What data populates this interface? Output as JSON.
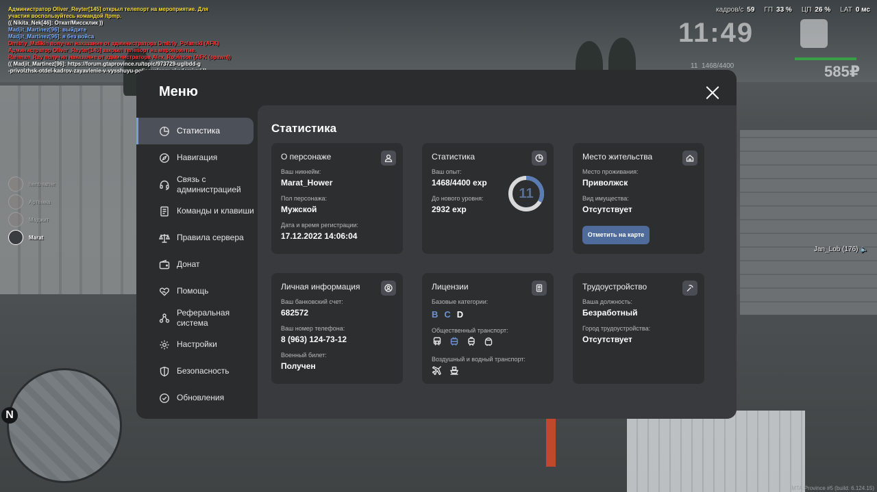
{
  "hud": {
    "fps_label": "кадров/с",
    "fps_value": "59",
    "gpu_label": "ГП",
    "gpu_value": "33 %",
    "cpu_label": "ЦП",
    "cpu_value": "26 %",
    "lat_label": "LAT",
    "lat_value": "0 мс",
    "time": "11:49",
    "xp": "1468/4400",
    "level_small": "11",
    "money": "585₽",
    "speaker": "Jan_Lob (176)",
    "build": "MTA:Province #5 (build: 6.124.15)"
  },
  "chat": [
    {
      "color": "c-admin",
      "text": "Администратор Oliver_Reyter[145] открыл телепорт на мероприятие. Для"
    },
    {
      "color": "c-admin",
      "text": " участия воспользуйтесь командой /tpmp."
    },
    {
      "color": "c-white",
      "text": "(( Nikita_Nek[46]: Откат/Миссклик ))"
    },
    {
      "color": "c-blue",
      "text": "Madjit_Martinez[96]: выйдите"
    },
    {
      "color": "c-blue",
      "text": "Madjit_Martinez[96]: я без войса"
    },
    {
      "color": "c-red",
      "text": "Dmitriy_Malikin получил наказание от администратора Dmitriy_Polanski (AFK)"
    },
    {
      "color": "c-red",
      "text": "Администратор Oliver_Reyter[145] закрыл телепорт на мероприятие."
    },
    {
      "color": "c-red",
      "text": "Rahman_Ray получил наказание от администратора Alex_Robinson (AFK (spawn))"
    },
    {
      "color": "c-white",
      "text": "(( Madjit_Martinez[96]: https://forum.gtaprovince.ru/topic/973729-ugibdd-g"
    },
    {
      "color": "c-white",
      "text": "-privolzhsk-otdel-kadrov-zayavlenie-v-vysshuyu-policeyskuyu-akademiyu/ ))"
    }
  ],
  "voice": [
    {
      "name": "hentreaher"
    },
    {
      "name": "Артёмка"
    },
    {
      "name": "Маджит"
    },
    {
      "name": "Marat"
    }
  ],
  "minimap": {
    "north": "N"
  },
  "menu": {
    "title": "Меню",
    "nav": [
      {
        "label": "Статистика",
        "icon": "pie-chart-icon",
        "active": true
      },
      {
        "label": "Навигация",
        "icon": "compass-icon"
      },
      {
        "label": "Связь с администрацией",
        "icon": "headset-icon"
      },
      {
        "label": "Команды и клавиши",
        "icon": "document-icon"
      },
      {
        "label": "Правила сервера",
        "icon": "scales-icon"
      },
      {
        "label": "Донат",
        "icon": "wallet-icon"
      },
      {
        "label": "Помощь",
        "icon": "heart-hands-icon"
      },
      {
        "label": "Реферальная система",
        "icon": "referral-icon"
      },
      {
        "label": "Настройки",
        "icon": "gear-icon"
      },
      {
        "label": "Безопасность",
        "icon": "shield-icon"
      },
      {
        "label": "Обновления",
        "icon": "refresh-icon"
      }
    ],
    "content_title": "Статистика",
    "character": {
      "title": "О персонаже",
      "nickname_label": "Ваш никнейм:",
      "nickname": "Marat_Hower",
      "gender_label": "Пол персонажа:",
      "gender": "Мужской",
      "reg_label": "Дата и время регистрации:",
      "reg": "17.12.2022 14:06:04"
    },
    "stats": {
      "title": "Статистика",
      "exp_label": "Ваш опыт:",
      "exp": "1468/4400 exp",
      "next_label": "До нового уровня:",
      "next": "2932 exp",
      "level": "11",
      "progress": 0.3336
    },
    "residence": {
      "title": "Место жительства",
      "place_label": "Место проживания:",
      "place": "Приволжск",
      "property_label": "Вид имущества:",
      "property": "Отсутствует",
      "map_button": "Отметить на карте"
    },
    "personal": {
      "title": "Личная информация",
      "bank_label": "Ваш банковский счет:",
      "bank": "682572",
      "phone_label": "Ваш номер телефона:",
      "phone": "8 (963) 124-73-12",
      "military_label": "Военный билет:",
      "military": "Получен"
    },
    "licenses": {
      "title": "Лицензии",
      "base_label": "Базовые категории:",
      "categories": [
        {
          "letter": "B",
          "owned": true
        },
        {
          "letter": "C",
          "owned": true
        },
        {
          "letter": "D",
          "owned": false
        }
      ],
      "public_label": "Общественный транспорт:",
      "public_icons": [
        {
          "icon": "bus-icon",
          "owned": false
        },
        {
          "icon": "trolleybus-icon",
          "owned": true
        },
        {
          "icon": "tram-icon",
          "owned": false
        },
        {
          "icon": "metro-icon",
          "owned": false
        }
      ],
      "air_label": "Воздушный и водный транспорт:",
      "air_icons": [
        {
          "icon": "plane-icon",
          "owned": false
        },
        {
          "icon": "boat-icon",
          "owned": false
        }
      ]
    },
    "job": {
      "title": "Трудоустройство",
      "position_label": "Ваша должность:",
      "position": "Безработный",
      "city_label": "Город трудоустройства:",
      "city": "Отсутствует"
    }
  },
  "colors": {
    "accent": "#7c9ed8",
    "modal_bg": "#2b2c2e",
    "content_bg": "#393a3d",
    "card_bg": "#2d2e30",
    "button_bg": "#4e6b9c"
  }
}
